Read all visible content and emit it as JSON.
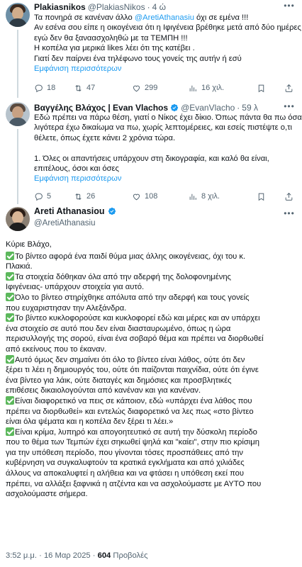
{
  "tweet1": {
    "name": "Plakiasnikos",
    "handle": "@PlakiasNikos",
    "sep": "·",
    "time": "4 ώ",
    "lines": [
      [
        "Τα πονηρά σε κανέναν άλλο ",
        "@AretiAthanasiu",
        " όχι σε εμένα !!!"
      ],
      [
        "Αν εσένα σου είπε η οικογένεια ότι η Ιφιγένεια βρέθηκε μετά από δύο ημέρες"
      ],
      [
        "εγώ δεν θα ξαναασχοληθώ με τα ΤΕΜΠΗ !!!"
      ],
      [
        "Η κοπέλα για μερικά likes λέει ότι της κατέβει ."
      ],
      [
        "Γιατί δεν παίρνει ένα τηλέφωνο τους γονείς της αυτήν ή εσύ"
      ]
    ],
    "show_more": "Εμφάνιση περισσότερων",
    "replies": "18",
    "retweets": "47",
    "likes": "299",
    "views": "16 χιλ."
  },
  "tweet2": {
    "name": "Βαγγέλης Βλάχος | Evan Vlachos",
    "handle": "@EvanVlacho",
    "sep": "·",
    "time": "59 λ",
    "lines": [
      "Εδώ πρέπει να πάρω θέση, γιατί ο Νίκος έχει δίκιο. Όπως πάντα θα πω όσα",
      "λιγότερα έχω δικαίωμα να πω, χωρίς λεπτομέρειες, και εσείς πιστέψτε ο,τι",
      "θέλετε, όπως έχετε κάνει 2 χρόνια τώρα.",
      "",
      "1. Όλες οι απαντήσεις υπάρχουν στη δικογραφία, και καλό θα είναι,",
      "επιτέλους, όσοι και όσες"
    ],
    "show_more": "Εμφάνιση περισσότερων",
    "replies": "5",
    "retweets": "26",
    "likes": "108",
    "views": "8 χιλ."
  },
  "main": {
    "name": "Areti Athanasiou",
    "handle": "@AretiAthanasiu",
    "greeting": "Κύριε Βλάχο,",
    "lines": [
      {
        "check": true,
        "text": "Το βίντεο αφορά ένα παιδί θύμα μιας άλλης οικογένειας, όχι του κ."
      },
      {
        "check": false,
        "text": "Πλακιά."
      },
      {
        "check": true,
        "text": "Τα στοιχεία δόθηκαν όλα από την αδερφή της δολοφονημένης"
      },
      {
        "check": false,
        "text": "Ιφιγένειας- υπάρχουν στοιχεία για αυτό."
      },
      {
        "check": true,
        "text": "Όλο το βίντεο στηρίχθηκε απόλυτα από την αδερφή και τους γονείς"
      },
      {
        "check": false,
        "text": "που ευχαριστησαν την Αλεξάνδρα."
      },
      {
        "check": true,
        "text": "Το βίντεο κυκλοφορούσε και κυκλοφορεί εδώ και μέρες και αν υπάρχει"
      },
      {
        "check": false,
        "text": "ένα στοιχείο σε αυτό που δεν είναι διασταυρωμένο, όπως  η ώρα"
      },
      {
        "check": false,
        "text": "περισυλλογής της σορού, είναι ένα σοβαρό θέμα και πρέπει να διορθωθεί"
      },
      {
        "check": false,
        "text": "από εκείνους που το έκαναν."
      },
      {
        "check": true,
        "text": "Αυτό όμως δεν σημαίνει ότι όλο το βίντεο είναι λάθος, ούτε ότι δεν"
      },
      {
        "check": false,
        "text": "ξέρει τι λέει η δημιουργός του, ούτε ότι παίζονται παιχνίδια, ούτε ότι έγινε"
      },
      {
        "check": false,
        "text": "ένα βίντεο για λάικ, ούτε διαταγές και δημόσιες και προσβλητικές"
      },
      {
        "check": false,
        "text": "επιθέσεις δικαιολογούνται από κανέναν και για κανέναν."
      },
      {
        "check": true,
        "text": "Είναι διαφορετικό να πεις σε κάποιον, εδώ «υπάρχει ένα λάθος που"
      },
      {
        "check": false,
        "text": "πρέπει να διορθωθεί» και εντελώς διαφορετικό να λες πως «στο βίντεο"
      },
      {
        "check": false,
        "text": "είναι όλα ψέματα και η κοπέλα δεν ξέρει τι λέει.»"
      },
      {
        "check": true,
        "text": "Είναι κρίμα, λυπηρό και απογοητευτικό σε αυτή την δύσκολη περίοδο"
      },
      {
        "check": false,
        "text": "που το θέμα των Τεμπών έχει σηκωθεί ψηλά και \"καίει\", στην πιο κρίσιμη"
      },
      {
        "check": false,
        "text": "για την υπόθεση περίοδο, που γίνονται τόσες προσπάθειες από την"
      },
      {
        "check": false,
        "text": "κυβέρνηση να συγκαλυφτούν  τα κρατικά εγκλήματα και από χιλιάδες"
      },
      {
        "check": false,
        "text": "άλλους να αποκαλυφτεί η αλήθεια και να φτάσει η υπόθεση εκεί που"
      },
      {
        "check": false,
        "text": "πρέπει, να αλλάξει ξαφνικά η ατζέντα και να ασχολούμαστε με ΑΥΤΟ που"
      },
      {
        "check": false,
        "text": "ασχολούμαστε σήμερα."
      }
    ],
    "time": "3:52 μ.μ.",
    "date": "16 Μαρ 2025",
    "views": "604",
    "views_label": "Προβολές"
  },
  "colors": {
    "accent": "#1d9bf0",
    "check_green": "#5cb85c",
    "muted": "#536471"
  }
}
